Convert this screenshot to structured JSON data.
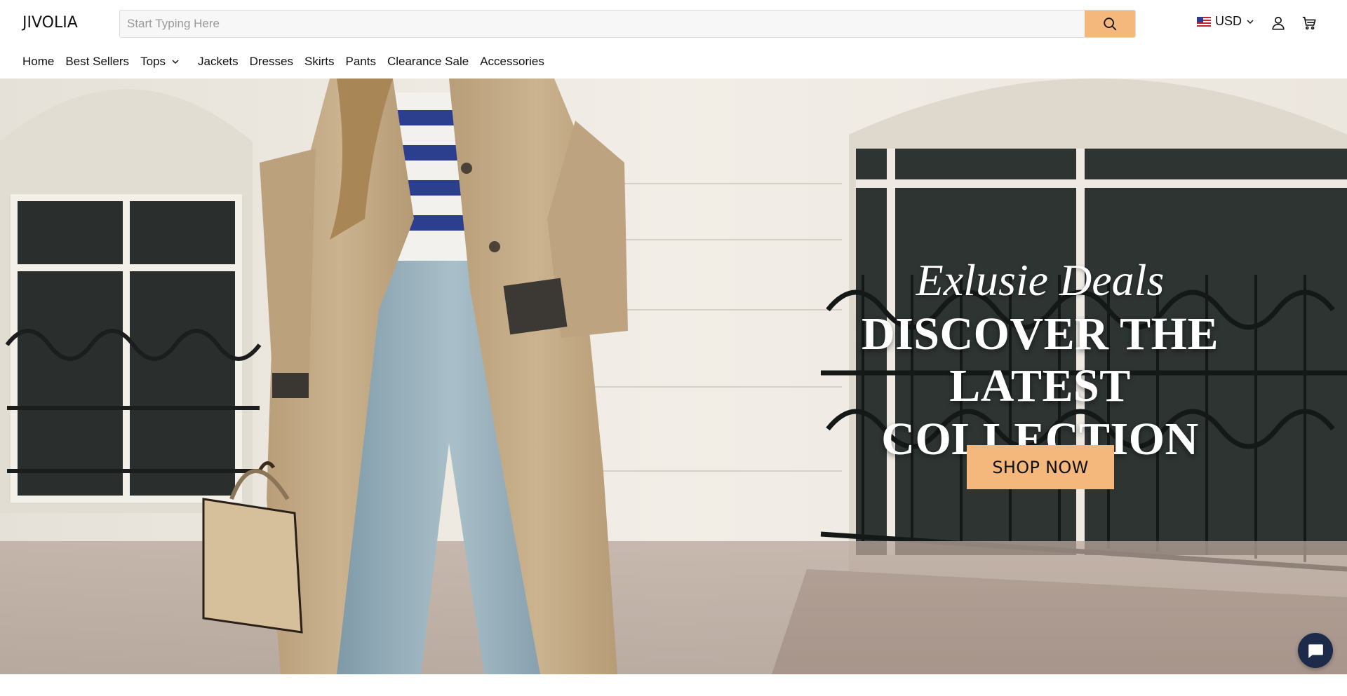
{
  "header": {
    "logo": "JIVOLIA",
    "search": {
      "placeholder": "Start Typing Here",
      "value": ""
    },
    "currency": {
      "label": "USD",
      "flag": "us-flag"
    },
    "icons": [
      "search-icon",
      "user-icon",
      "cart-icon",
      "chevron-down-icon"
    ]
  },
  "nav": {
    "items": [
      {
        "label": "Home"
      },
      {
        "label": "Best Sellers"
      },
      {
        "label": "Tops",
        "has_dropdown": true
      },
      {
        "label": "Jackets"
      },
      {
        "label": "Dresses"
      },
      {
        "label": "Skirts"
      },
      {
        "label": "Pants"
      },
      {
        "label": "Clearance Sale"
      },
      {
        "label": "Accessories"
      }
    ]
  },
  "hero": {
    "subtitle": "Exlusie Deals",
    "title_line1": "DISCOVER THE LATEST",
    "title_line2": "COLLECTION",
    "cta_label": "SHOP NOW"
  },
  "chat": {
    "icon": "chat-icon"
  },
  "colors": {
    "accent": "#f4b77c",
    "text": "#111111",
    "chat": "#1e2a4a"
  }
}
